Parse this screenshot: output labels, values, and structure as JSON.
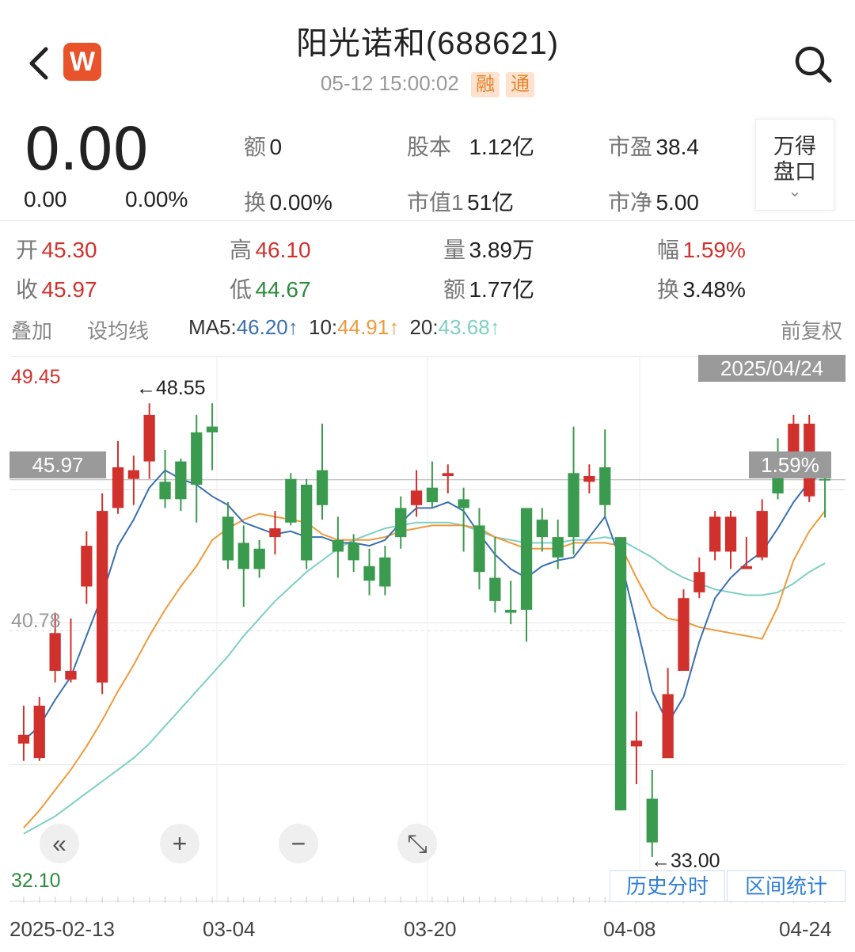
{
  "header": {
    "title": "阳光诺和(688621)",
    "datetime": "05-12 15:00:02",
    "tags": [
      "融",
      "通"
    ],
    "logo_letter": "W"
  },
  "quote": {
    "price": "0.00",
    "change": "0.00",
    "change_pct": "0.00%",
    "amount_label": "额",
    "amount_value": "0",
    "turnover_label": "换",
    "turnover_value": "0.00%",
    "share_cap_label": "股本",
    "share_cap_value": "1.12亿",
    "mkt_cap_label": "市值1",
    "mkt_cap_value": "51亿",
    "pe_label": "市盈",
    "pe_value": "38.4",
    "pb_label": "市净",
    "pb_value": "5.00",
    "panel_button_line1": "万得",
    "panel_button_line2": "盘口",
    "panel_chevron": "⌄"
  },
  "day_stats": {
    "open_label": "开",
    "open_value": "45.30",
    "close_label": "收",
    "close_value": "45.97",
    "high_label": "高",
    "high_value": "46.10",
    "low_label": "低",
    "low_value": "44.67",
    "volume_label": "量",
    "volume_value": "3.89万",
    "amount_label": "额",
    "amount_value": "1.77亿",
    "amplitude_label": "幅",
    "amplitude_value": "1.59%",
    "turnover_label": "换",
    "turnover_value": "3.48%"
  },
  "toolbar": {
    "overlay": "叠加",
    "set_ma": "设均线",
    "ma5_label": "MA5:",
    "ma5_value": "46.20↑",
    "ma10_label": "10:",
    "ma10_value": "44.91↑",
    "ma20_label": "20:",
    "ma20_value": "43.68↑",
    "adjust": "前复权"
  },
  "chart_data": {
    "type": "candlestick",
    "y_max_label": "49.45",
    "y_mid_label": "40.78",
    "y_min_label": "32.10",
    "ylim": [
      32.1,
      49.45
    ],
    "current_price_label": "45.97",
    "current_pct_label": "1.59%",
    "selected_date_label": "2025/04/24",
    "max_annotation": "48.55",
    "min_annotation": "33.00",
    "x_tick_labels": [
      "2025-02-13",
      "03-04",
      "03-20",
      "04-08",
      "04-24"
    ],
    "candles": [
      {
        "o": 36.9,
        "c": 37.2,
        "h": 38.2,
        "l": 36.3
      },
      {
        "o": 36.4,
        "c": 38.2,
        "h": 38.5,
        "l": 36.3
      },
      {
        "o": 39.4,
        "c": 40.7,
        "h": 41.4,
        "l": 39.0
      },
      {
        "o": 39.1,
        "c": 39.4,
        "h": 41.2,
        "l": 39.0
      },
      {
        "o": 42.3,
        "c": 43.7,
        "h": 44.2,
        "l": 41.7
      },
      {
        "o": 39.0,
        "c": 44.9,
        "h": 45.5,
        "l": 38.6
      },
      {
        "o": 45.0,
        "c": 46.4,
        "h": 47.3,
        "l": 44.8
      },
      {
        "o": 46.0,
        "c": 46.3,
        "h": 46.8,
        "l": 45.1
      },
      {
        "o": 46.6,
        "c": 48.2,
        "h": 48.6,
        "l": 46.0
      },
      {
        "o": 45.9,
        "c": 45.3,
        "h": 47.0,
        "l": 45.0
      },
      {
        "o": 46.6,
        "c": 45.3,
        "h": 46.7,
        "l": 44.9
      },
      {
        "o": 47.6,
        "c": 45.8,
        "h": 48.2,
        "l": 44.5
      },
      {
        "o": 47.8,
        "c": 47.6,
        "h": 48.6,
        "l": 46.3
      },
      {
        "o": 44.7,
        "c": 43.2,
        "h": 45.2,
        "l": 42.9
      },
      {
        "o": 43.8,
        "c": 42.9,
        "h": 44.4,
        "l": 41.6
      },
      {
        "o": 43.6,
        "c": 42.9,
        "h": 43.9,
        "l": 42.6
      },
      {
        "o": 44.0,
        "c": 44.3,
        "h": 44.9,
        "l": 43.4
      },
      {
        "o": 46.0,
        "c": 44.5,
        "h": 46.2,
        "l": 44.4
      },
      {
        "o": 45.8,
        "c": 43.2,
        "h": 46.0,
        "l": 42.9
      },
      {
        "o": 46.3,
        "c": 45.1,
        "h": 47.9,
        "l": 44.6
      },
      {
        "o": 43.9,
        "c": 43.5,
        "h": 44.7,
        "l": 42.6
      },
      {
        "o": 43.8,
        "c": 43.2,
        "h": 44.1,
        "l": 42.8
      },
      {
        "o": 43.0,
        "c": 42.5,
        "h": 43.6,
        "l": 42.0
      },
      {
        "o": 43.3,
        "c": 42.3,
        "h": 43.7,
        "l": 42.0
      },
      {
        "o": 45.0,
        "c": 44.0,
        "h": 45.4,
        "l": 43.6
      },
      {
        "o": 45.1,
        "c": 45.6,
        "h": 46.3,
        "l": 44.7
      },
      {
        "o": 45.7,
        "c": 45.2,
        "h": 46.6,
        "l": 45.0
      },
      {
        "o": 46.1,
        "c": 46.2,
        "h": 46.5,
        "l": 45.5
      },
      {
        "o": 45.3,
        "c": 45.0,
        "h": 45.7,
        "l": 43.5
      },
      {
        "o": 44.4,
        "c": 42.8,
        "h": 45.0,
        "l": 42.2
      },
      {
        "o": 42.6,
        "c": 41.8,
        "h": 44.0,
        "l": 41.4
      },
      {
        "o": 41.5,
        "c": 41.4,
        "h": 42.5,
        "l": 41.0
      },
      {
        "o": 45.0,
        "c": 41.5,
        "h": 45.0,
        "l": 40.4
      },
      {
        "o": 44.6,
        "c": 44.0,
        "h": 45.0,
        "l": 43.5
      },
      {
        "o": 44.0,
        "c": 43.3,
        "h": 44.6,
        "l": 42.9
      },
      {
        "o": 46.2,
        "c": 44.0,
        "h": 47.8,
        "l": 43.4
      },
      {
        "o": 45.9,
        "c": 46.1,
        "h": 46.5,
        "l": 45.5
      },
      {
        "o": 46.4,
        "c": 45.1,
        "h": 47.7,
        "l": 44.7
      },
      {
        "o": 44.0,
        "c": 34.6,
        "h": 44.0,
        "l": 34.6
      },
      {
        "o": 36.8,
        "c": 37.0,
        "h": 38.0,
        "l": 35.5
      },
      {
        "o": 35.0,
        "c": 33.5,
        "h": 36.0,
        "l": 33.0
      },
      {
        "o": 36.4,
        "c": 38.6,
        "h": 39.5,
        "l": 36.4
      },
      {
        "o": 39.4,
        "c": 41.9,
        "h": 42.2,
        "l": 39.4
      },
      {
        "o": 42.1,
        "c": 42.8,
        "h": 43.3,
        "l": 41.9
      },
      {
        "o": 43.5,
        "c": 44.7,
        "h": 44.9,
        "l": 43.2
      },
      {
        "o": 43.5,
        "c": 44.7,
        "h": 44.9,
        "l": 42.9
      },
      {
        "o": 42.9,
        "c": 43.0,
        "h": 44.0,
        "l": 42.9
      },
      {
        "o": 43.3,
        "c": 44.9,
        "h": 45.3,
        "l": 43.2
      },
      {
        "o": 46.8,
        "c": 45.5,
        "h": 47.4,
        "l": 45.3
      },
      {
        "o": 46.5,
        "c": 47.9,
        "h": 48.2,
        "l": 46.3
      },
      {
        "o": 45.4,
        "c": 47.9,
        "h": 48.2,
        "l": 45.2
      },
      {
        "o": 46.0,
        "c": 45.97,
        "h": 46.1,
        "l": 44.67
      }
    ],
    "ma5": [
      37.0,
      37.5,
      38.4,
      39.2,
      40.6,
      42.0,
      43.7,
      44.6,
      45.7,
      46.3,
      46.0,
      45.8,
      45.4,
      45.1,
      44.5,
      44.3,
      44.1,
      44.2,
      44.0,
      44.0,
      43.8,
      43.8,
      43.7,
      43.9,
      44.5,
      45.0,
      45.0,
      45.2,
      44.9,
      44.1,
      43.4,
      42.9,
      42.6,
      43.0,
      43.2,
      43.3,
      44.0,
      44.7,
      43.2,
      41.0,
      38.7,
      37.6,
      38.5,
      40.4,
      41.9,
      42.6,
      43.1,
      43.5,
      44.3,
      45.2,
      45.9,
      46.2
    ],
    "ma10": [
      34.0,
      34.6,
      35.3,
      36.0,
      36.8,
      37.7,
      38.7,
      39.6,
      40.6,
      41.5,
      42.3,
      43.0,
      43.9,
      44.3,
      44.6,
      44.8,
      44.7,
      44.6,
      44.5,
      44.1,
      43.9,
      43.9,
      43.9,
      44.0,
      44.2,
      44.3,
      44.4,
      44.4,
      44.4,
      44.3,
      44.0,
      43.8,
      43.6,
      43.6,
      43.6,
      43.8,
      43.8,
      43.8,
      43.7,
      42.6,
      41.6,
      41.2,
      41.1,
      40.9,
      40.8,
      40.7,
      40.6,
      40.5,
      41.6,
      43.2,
      44.2,
      44.9
    ],
    "ma20": [
      33.8,
      34.1,
      34.4,
      34.8,
      35.2,
      35.6,
      36.0,
      36.4,
      36.9,
      37.5,
      38.1,
      38.7,
      39.3,
      39.9,
      40.6,
      41.2,
      41.8,
      42.3,
      42.8,
      43.2,
      43.6,
      43.9,
      44.1,
      44.3,
      44.4,
      44.5,
      44.5,
      44.5,
      44.4,
      44.2,
      44.0,
      43.9,
      43.8,
      43.8,
      43.8,
      43.9,
      43.9,
      44.0,
      43.9,
      43.6,
      43.3,
      42.9,
      42.6,
      42.4,
      42.2,
      42.1,
      42.0,
      42.0,
      42.1,
      42.4,
      42.8,
      43.1
    ],
    "colors": {
      "up": "#d0312d",
      "down": "#3a9a4e",
      "ma5": "#3a6fb0",
      "ma10": "#ef9a3a",
      "ma20": "#7ecfc6"
    }
  },
  "chart_controls": {
    "rewind_icon": "«",
    "zoom_in_icon": "+",
    "zoom_out_icon": "−",
    "fullscreen_icon": "⤡"
  },
  "bottom_buttons": {
    "history_intraday": "历史分时",
    "range_stats": "区间统计"
  }
}
